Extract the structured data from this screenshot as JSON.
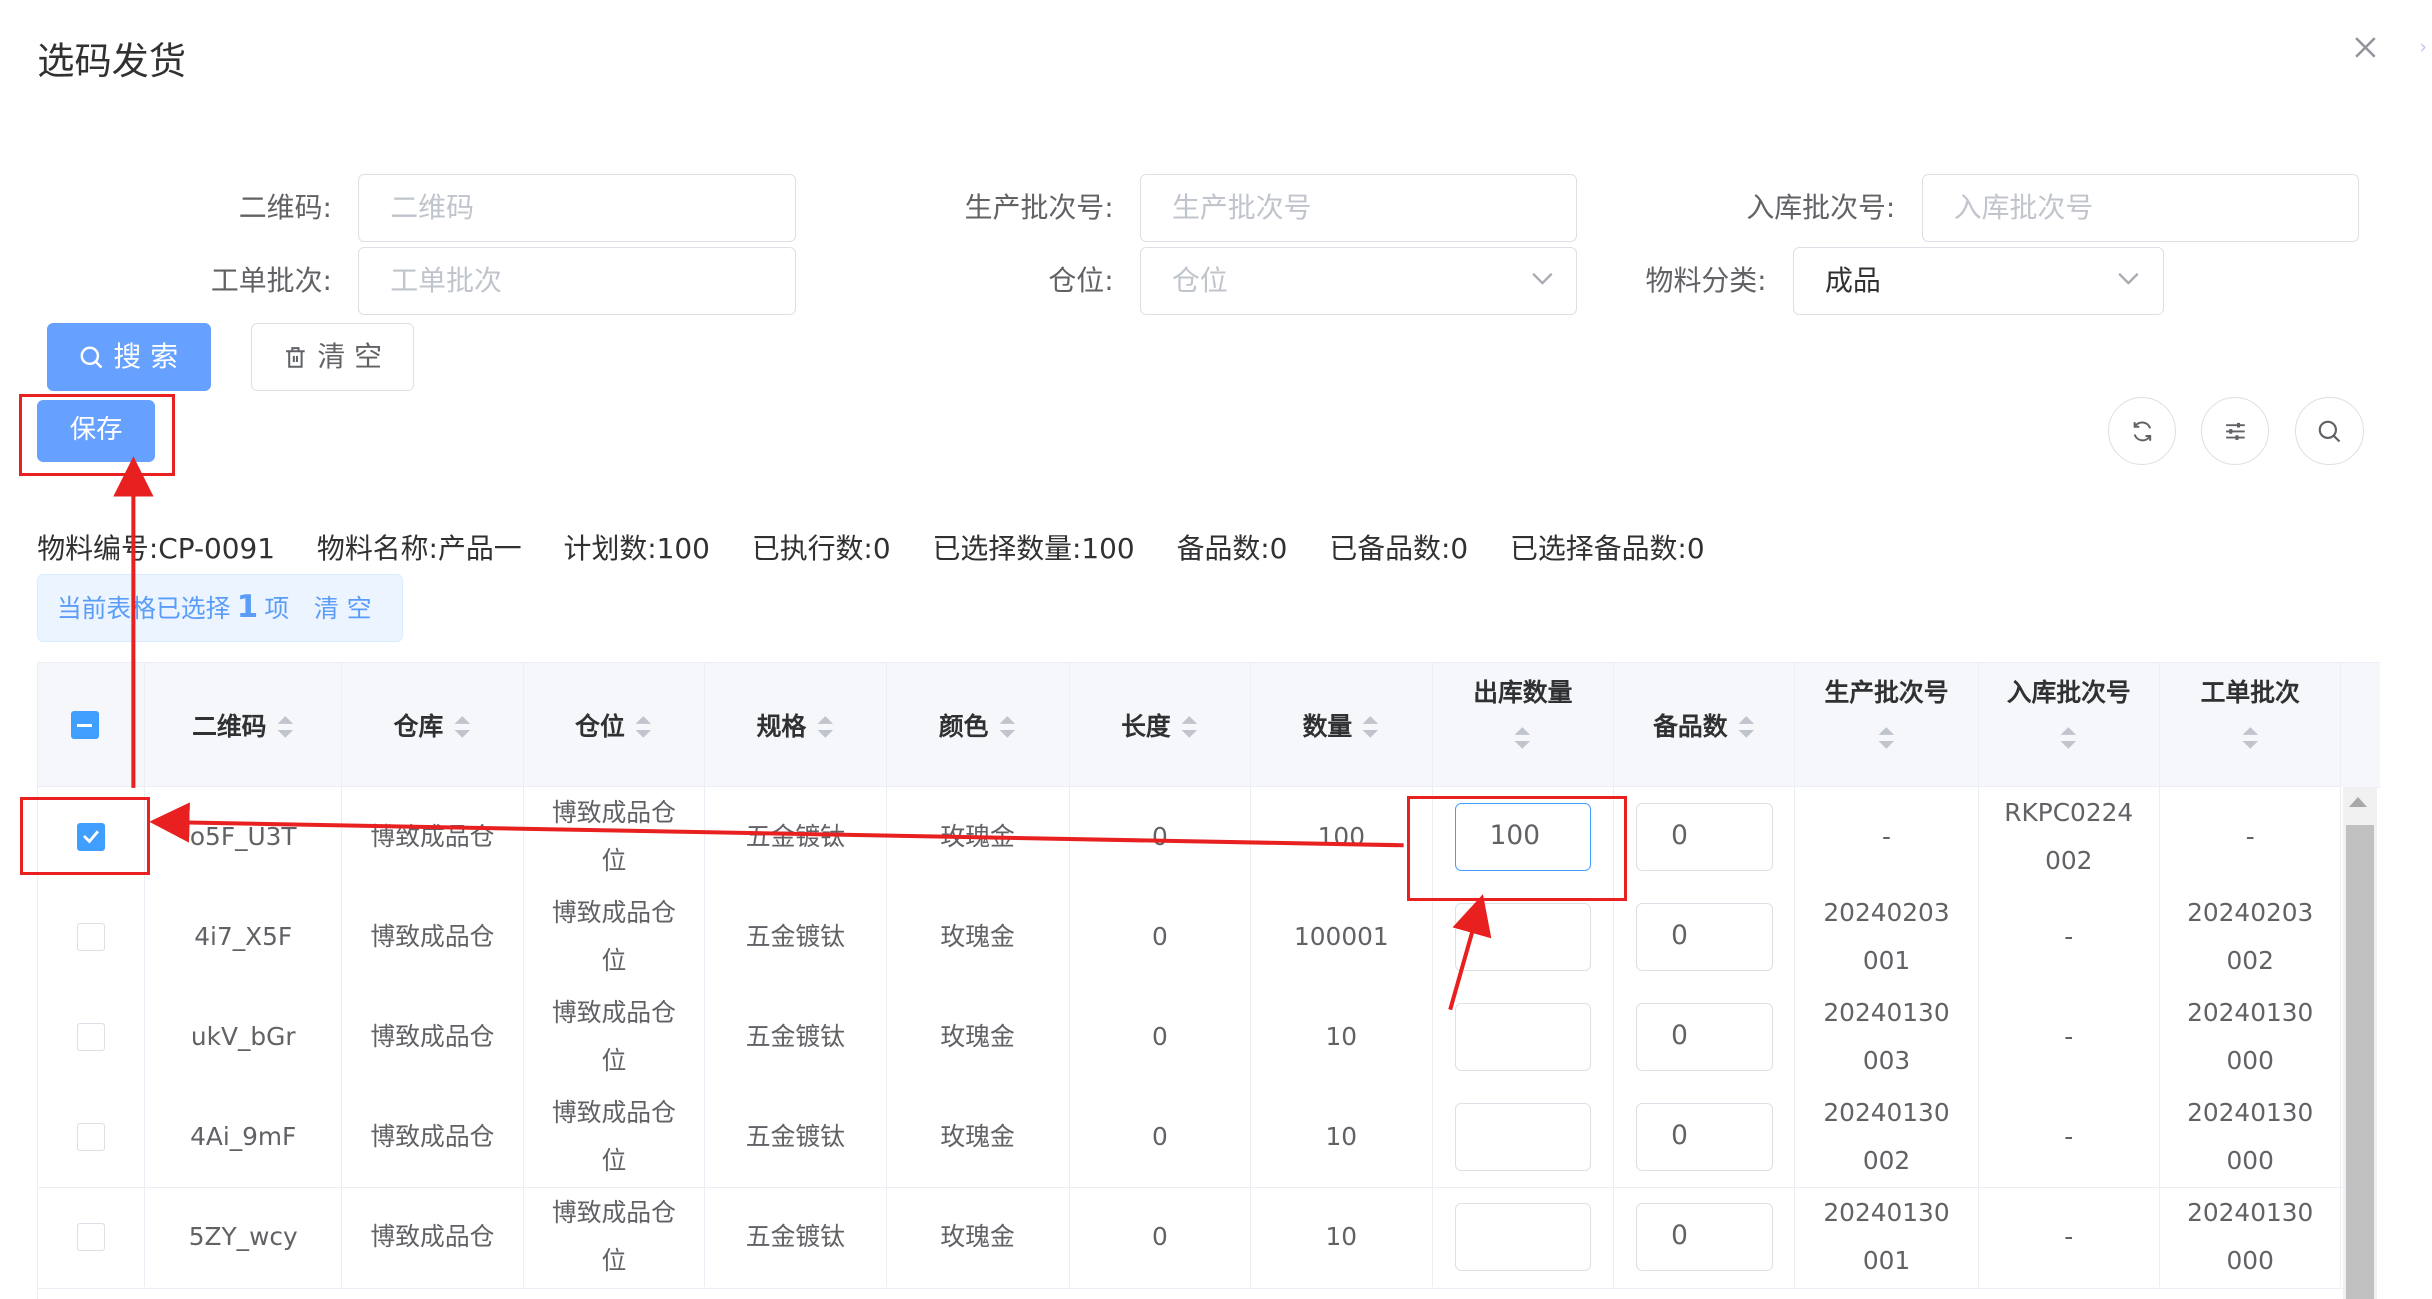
{
  "dialog": {
    "title": "选码发货"
  },
  "filters": {
    "qr_label": "二维码:",
    "qr_placeholder": "二维码",
    "prod_batch_label": "生产批次号:",
    "prod_batch_placeholder": "生产批次号",
    "in_batch_label": "入库批次号:",
    "in_batch_placeholder": "入库批次号",
    "work_batch_label": "工单批次:",
    "work_batch_placeholder": "工单批次",
    "location_label": "仓位:",
    "location_placeholder": "仓位",
    "category_label": "物料分类:",
    "category_value": "成品"
  },
  "toolbar": {
    "search_label": "搜 索",
    "clear_label": "清 空",
    "save_label": "保存"
  },
  "summary": {
    "material_code": "物料编号:CP-0091",
    "material_name": "物料名称:产品一",
    "plan": "计划数:100",
    "executed": "已执行数:0",
    "selected_qty": "已选择数量:100",
    "spare": "备品数:0",
    "spared": "已备品数:0",
    "selected_spare": "已选择备品数:0"
  },
  "selection": {
    "prefix": "当前表格已选择",
    "count": "1",
    "suffix": "项",
    "clear": "清 空"
  },
  "table": {
    "headers": {
      "qr": "二维码",
      "warehouse": "仓库",
      "location": "仓位",
      "spec": "规格",
      "color": "颜色",
      "length": "长度",
      "qty": "数量",
      "out_qty": "出库数量",
      "spare": "备品数",
      "prod_batch": "生产批次号",
      "in_batch": "入库批次号",
      "work_batch": "工单批次"
    },
    "rows": [
      {
        "checked": true,
        "qr": "o5F_U3T",
        "warehouse": "博致成品仓",
        "location": "博致成品仓位",
        "spec": "五金镀钛",
        "color": "玫瑰金",
        "length": "0",
        "qty": "100",
        "out_qty": "100",
        "spare": "0",
        "prod_batch": "-",
        "in_batch": "RKPC0224002",
        "work_batch": "-"
      },
      {
        "checked": false,
        "qr": "4i7_X5F",
        "warehouse": "博致成品仓",
        "location": "博致成品仓位",
        "spec": "五金镀钛",
        "color": "玫瑰金",
        "length": "0",
        "qty": "100001",
        "out_qty": "",
        "spare": "0",
        "prod_batch": "20240203001",
        "in_batch": "-",
        "work_batch": "20240203002"
      },
      {
        "checked": false,
        "qr": "ukV_bGr",
        "warehouse": "博致成品仓",
        "location": "博致成品仓位",
        "spec": "五金镀钛",
        "color": "玫瑰金",
        "length": "0",
        "qty": "10",
        "out_qty": "",
        "spare": "0",
        "prod_batch": "20240130003",
        "in_batch": "-",
        "work_batch": "20240130000"
      },
      {
        "checked": false,
        "qr": "4Ai_9mF",
        "warehouse": "博致成品仓",
        "location": "博致成品仓位",
        "spec": "五金镀钛",
        "color": "玫瑰金",
        "length": "0",
        "qty": "10",
        "out_qty": "",
        "spare": "0",
        "prod_batch": "20240130002",
        "in_batch": "-",
        "work_batch": "20240130000"
      },
      {
        "checked": false,
        "qr": "5ZY_wcy",
        "warehouse": "博致成品仓",
        "location": "博致成品仓位",
        "spec": "五金镀钛",
        "color": "玫瑰金",
        "length": "0",
        "qty": "10",
        "out_qty": "",
        "spare": "0",
        "prod_batch": "20240130001",
        "in_batch": "-",
        "work_batch": "20240130000"
      }
    ]
  },
  "colors": {
    "primary": "#66a1ff",
    "annotation": "#e82020"
  }
}
